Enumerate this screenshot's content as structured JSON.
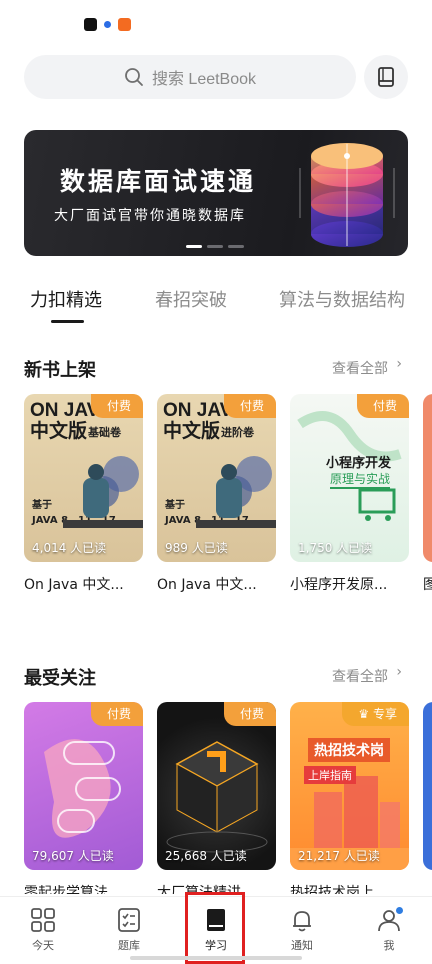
{
  "search": {
    "placeholder": "搜索 LeetBook"
  },
  "banner": {
    "title": "数据库面试速通",
    "subtitle": "大厂面试官带你通晓数据库",
    "page_count": 3,
    "active_page": 1
  },
  "tabs": [
    {
      "label": "力扣精选",
      "active": true
    },
    {
      "label": "春招突破",
      "active": false
    },
    {
      "label": "算法与数据结构",
      "active": false
    }
  ],
  "sections": {
    "new_books": {
      "title": "新书上架",
      "more": "查看全部",
      "books": [
        {
          "cover_title": "ON JAVA\n中文版",
          "cover_tag": "基础卷",
          "cover_note": "基于\nJAVA 8、11、17",
          "badge": "付费",
          "readers": "4,014 人已读",
          "title": "On Java 中文..."
        },
        {
          "cover_title": "ON JAVA\n中文版",
          "cover_tag": "进阶卷",
          "cover_note": "基于\nJAVA 8、11、17",
          "badge": "付费",
          "readers": "989 人已读",
          "title": "On Java 中文..."
        },
        {
          "cover_title": "小程序开发",
          "cover_tag": "原理与实战",
          "badge": "付费",
          "readers": "1,750 人已读",
          "title": "小程序开发原..."
        }
      ],
      "peek_title": "图"
    },
    "popular": {
      "title": "最受关注",
      "more": "查看全部",
      "books": [
        {
          "badge": "付费",
          "readers": "79,607 人已读",
          "title": "零起步学算法"
        },
        {
          "badge": "付费",
          "readers": "25,668 人已读",
          "title": "大厂算法精讲"
        },
        {
          "badge": "专享",
          "cover_title": "热招技术岗",
          "cover_tag": "上岸指南",
          "readers": "21,217 人已读",
          "title": "热招技术岗上..."
        }
      ]
    }
  },
  "bottom_nav": [
    {
      "label": "今天",
      "icon": "grid-icon",
      "active": false
    },
    {
      "label": "题库",
      "icon": "checklist-icon",
      "active": false
    },
    {
      "label": "学习",
      "icon": "book-icon",
      "active": true
    },
    {
      "label": "通知",
      "icon": "bell-icon",
      "active": false
    },
    {
      "label": "我",
      "icon": "person-icon",
      "active": false
    }
  ]
}
